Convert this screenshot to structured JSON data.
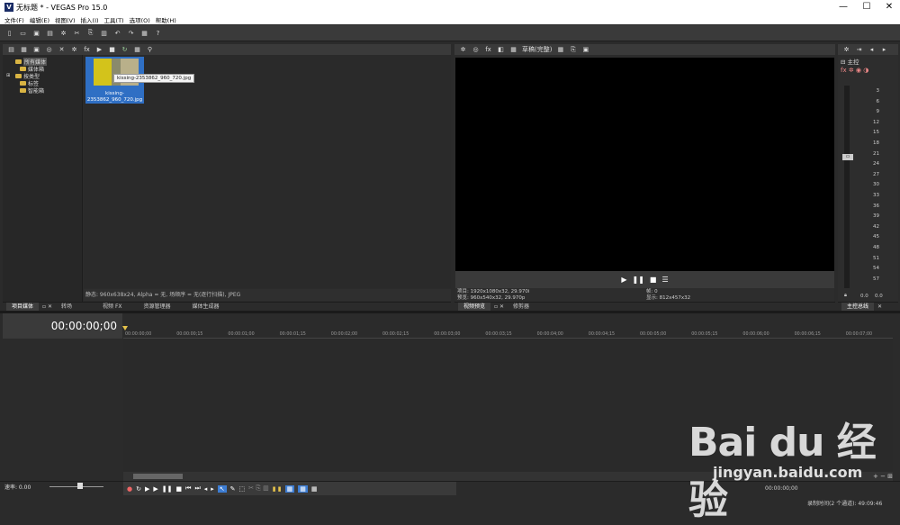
{
  "window": {
    "title": "无标题 * - VEGAS Pro 15.0",
    "logo": "V",
    "controls": [
      "—",
      "☐",
      "✕"
    ]
  },
  "menu": [
    "文件(F)",
    "编辑(E)",
    "视图(V)",
    "插入(I)",
    "工具(T)",
    "选项(O)",
    "帮助(H)"
  ],
  "toolbar_icons": [
    "new-icon",
    "open-icon",
    "save-icon",
    "save-as-icon",
    "gear-icon",
    "cut-icon",
    "copy-icon",
    "paste-icon",
    "undo-icon",
    "redo-icon",
    "render-icon",
    "help-icon"
  ],
  "explorer": {
    "tree": [
      "所有媒体",
      "媒体箱",
      "按类型",
      "标签",
      "智能箱"
    ],
    "media": {
      "filename": "kissing-2353862_960_720.jpg",
      "caption": "kissing-2353862_960_720.jpg",
      "tooltip": "kissing-2353862_960_720.jpg"
    },
    "status": "静态: 960x638x24, Alpha = 无, 场顺序 = 无(逐行扫描), JPEG",
    "tabs": [
      "项目媒体",
      "转场",
      "视频 FX",
      "资源管理器",
      "媒体生成器"
    ]
  },
  "preview": {
    "quality": "草稿(完整)",
    "project": "项目: 1920x1080x32, 29.970i",
    "preview_res": "预览: 960x540x32, 29.970p",
    "frame": "帧: 0",
    "display": "显示: 812x457x32",
    "tabs": [
      "视频预览",
      "修剪器"
    ]
  },
  "master": {
    "label": "主控",
    "scale": [
      "3",
      "6",
      "9",
      "12",
      "15",
      "18",
      "21",
      "24",
      "27",
      "30",
      "33",
      "36",
      "39",
      "42",
      "45",
      "48",
      "51",
      "54",
      "57"
    ],
    "readout_l": "0.0",
    "readout_r": "0.0",
    "tab": "主控总线"
  },
  "timeline": {
    "time": "00:00:00;00",
    "ruler": [
      "00:00:00;00",
      "00:00:00;15",
      "00:00:01;00",
      "00:00:01;15",
      "00:00:02;00",
      "00:00:02;15",
      "00:00:03;00",
      "00:00:03;15",
      "00:00:04;00",
      "00:00:04;15",
      "00:00:05;00",
      "00:00:05;15",
      "00:00:06;00",
      "00:00:06;15",
      "00:00:07;00"
    ],
    "rate": "速率: 0.00",
    "end_time": "00:00:00;00",
    "record_status": "录制时间(2 个通道): 49:09:46"
  },
  "watermark": {
    "brand": "Bai du 经验",
    "url": "jingyan.baidu.com"
  }
}
